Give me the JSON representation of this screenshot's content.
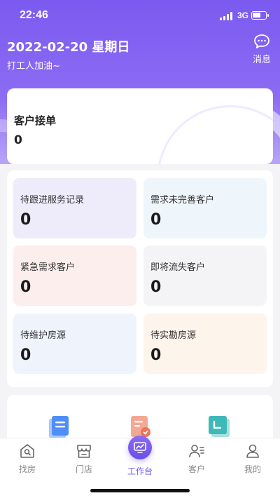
{
  "status_bar": {
    "time": "22:46",
    "network": "3G"
  },
  "header": {
    "date": "2022-02-20 星期日",
    "slogan": "打工人加油~",
    "message_label": "消息"
  },
  "order_card": {
    "title": "客户接单",
    "value": "0"
  },
  "stats": [
    {
      "label": "待跟进服务记录",
      "value": "0",
      "bg": "#eeecfb"
    },
    {
      "label": "需求未完善客户",
      "value": "0",
      "bg": "#eef6fc"
    },
    {
      "label": "紧急需求客户",
      "value": "0",
      "bg": "#fbeeec"
    },
    {
      "label": "即将流失客户",
      "value": "0",
      "bg": "#f4f4f6"
    },
    {
      "label": "待维护房源",
      "value": "0",
      "bg": "#eef3fc"
    },
    {
      "label": "待实勘房源",
      "value": "0",
      "bg": "#fdf4ec"
    }
  ],
  "tools": [
    {
      "icon": "document-icon",
      "color": "#4f8ef7"
    },
    {
      "icon": "report-icon",
      "color": "#f08a6e"
    },
    {
      "icon": "folder-icon",
      "color": "#3fb8b8"
    }
  ],
  "tabbar": {
    "items": [
      {
        "label": "找房",
        "icon": "house-search-icon"
      },
      {
        "label": "门店",
        "icon": "store-icon"
      },
      {
        "label": "工作台",
        "icon": "dashboard-icon"
      },
      {
        "label": "客户",
        "icon": "customer-icon"
      },
      {
        "label": "我的",
        "icon": "profile-icon"
      }
    ],
    "active_index": 2,
    "active_color": "#7257ee"
  }
}
